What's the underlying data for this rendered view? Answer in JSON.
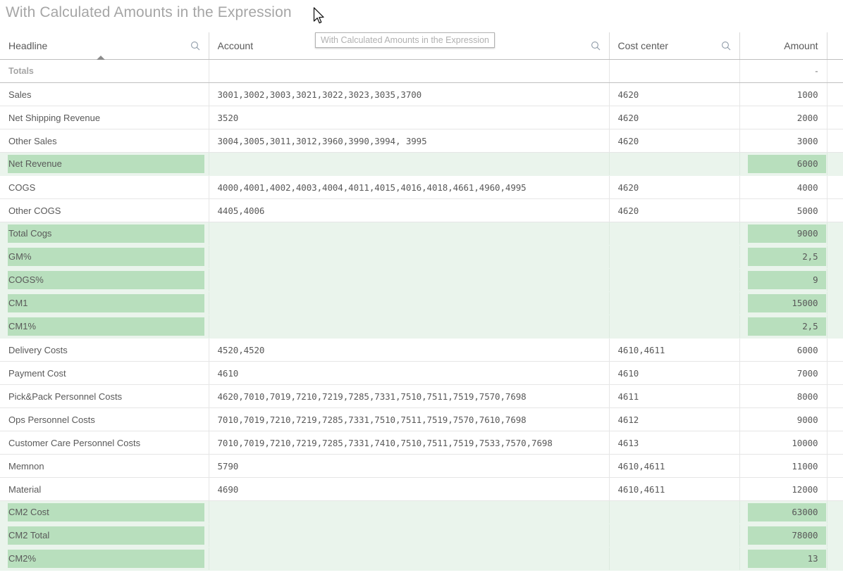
{
  "chart": {
    "title": "With Calculated Amounts in the Expression",
    "tooltip": "With Calculated Amounts in the Expression"
  },
  "table": {
    "columns": [
      {
        "label": "Headline",
        "align": "left",
        "searchable": true,
        "sorted": "asc"
      },
      {
        "label": "Account",
        "align": "left",
        "searchable": true,
        "sorted": "none"
      },
      {
        "label": "Cost center",
        "align": "left",
        "searchable": true,
        "sorted": "none"
      },
      {
        "label": "Amount",
        "align": "right",
        "searchable": false,
        "sorted": "none"
      }
    ],
    "totals_label": "Totals",
    "totals_amount": "-",
    "rows": [
      {
        "headline": "Sales",
        "account": "3001,3002,3003,3021,3022,3023,3035,3700",
        "cost_center": "4620",
        "amount": "1000",
        "highlight": false
      },
      {
        "headline": "Net Shipping Revenue",
        "account": "3520",
        "cost_center": "4620",
        "amount": "2000",
        "highlight": false
      },
      {
        "headline": "Other Sales",
        "account": "3004,3005,3011,3012,3960,3990,3994, 3995",
        "cost_center": "4620",
        "amount": "3000",
        "highlight": false
      },
      {
        "headline": "Net Revenue",
        "account": "",
        "cost_center": "",
        "amount": "6000",
        "highlight": true
      },
      {
        "headline": "COGS",
        "account": "4000,4001,4002,4003,4004,4011,4015,4016,4018,4661,4960,4995",
        "cost_center": "4620",
        "amount": "4000",
        "highlight": false
      },
      {
        "headline": "Other COGS",
        "account": "4405,4006",
        "cost_center": "4620",
        "amount": "5000",
        "highlight": false
      },
      {
        "headline": "Total Cogs",
        "account": "",
        "cost_center": "",
        "amount": "9000",
        "highlight": true
      },
      {
        "headline": "GM%",
        "account": "",
        "cost_center": "",
        "amount": "2,5",
        "highlight": true
      },
      {
        "headline": "COGS%",
        "account": "",
        "cost_center": "",
        "amount": "9",
        "highlight": true
      },
      {
        "headline": "CM1",
        "account": "",
        "cost_center": "",
        "amount": "15000",
        "highlight": true
      },
      {
        "headline": "CM1%",
        "account": "",
        "cost_center": "",
        "amount": "2,5",
        "highlight": true
      },
      {
        "headline": "Delivery Costs",
        "account": "4520,4520",
        "cost_center": "4610,4611",
        "amount": "6000",
        "highlight": false
      },
      {
        "headline": "Payment Cost",
        "account": "4610",
        "cost_center": "4610",
        "amount": "7000",
        "highlight": false
      },
      {
        "headline": "Pick&Pack Personnel Costs",
        "account": "4620,7010,7019,7210,7219,7285,7331,7510,7511,7519,7570,7698",
        "cost_center": "4611",
        "amount": "8000",
        "highlight": false
      },
      {
        "headline": "Ops Personnel Costs",
        "account": "7010,7019,7210,7219,7285,7331,7510,7511,7519,7570,7610,7698",
        "cost_center": "4612",
        "amount": "9000",
        "highlight": false
      },
      {
        "headline": "Customer Care Personnel Costs",
        "account": "7010,7019,7210,7219,7285,7331,7410,7510,7511,7519,7533,7570,7698",
        "cost_center": "4613",
        "amount": "10000",
        "highlight": false
      },
      {
        "headline": "Memnon",
        "account": "5790",
        "cost_center": "4610,4611",
        "amount": "11000",
        "highlight": false
      },
      {
        "headline": "Material",
        "account": "4690",
        "cost_center": "4610,4611",
        "amount": "12000",
        "highlight": false
      },
      {
        "headline": "CM2 Cost",
        "account": "",
        "cost_center": "",
        "amount": "63000",
        "highlight": true
      },
      {
        "headline": "CM2 Total",
        "account": "",
        "cost_center": "",
        "amount": "78000",
        "highlight": true
      },
      {
        "headline": "CM2%",
        "account": "",
        "cost_center": "",
        "amount": "13",
        "highlight": true
      }
    ]
  },
  "colors": {
    "bar_fill": "#b8dfbd",
    "highlight_row_bg": "#eaf4ec",
    "text": "#595959",
    "title": "#a6a6a6"
  }
}
